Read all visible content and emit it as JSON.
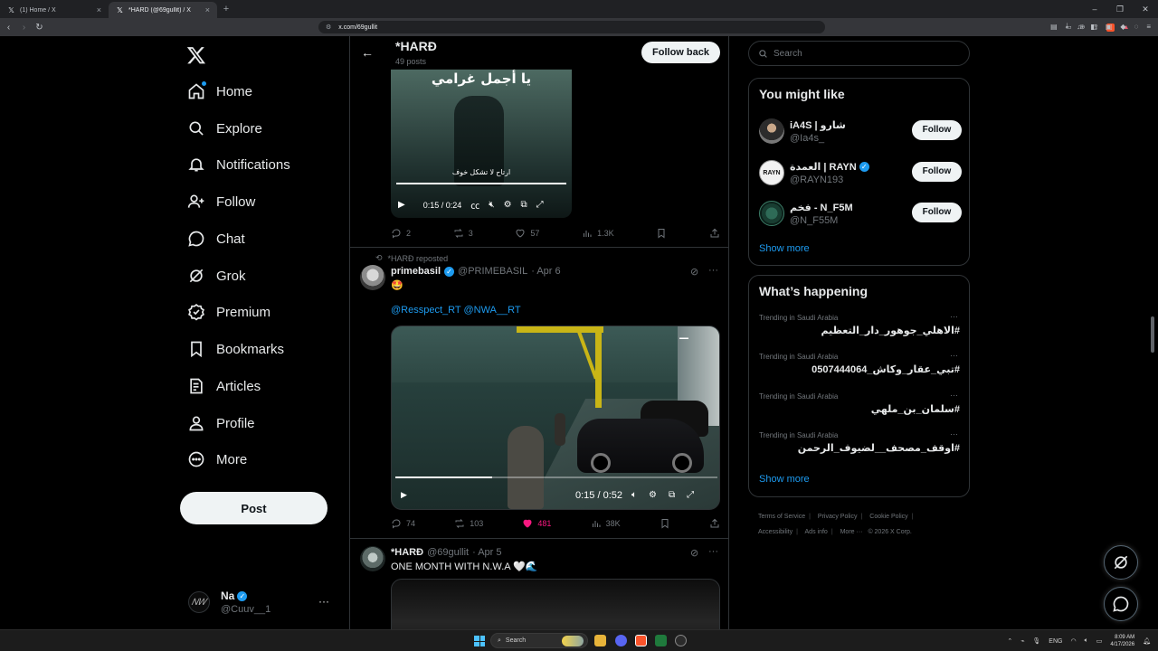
{
  "browser": {
    "tabs": [
      {
        "title": "(1) Home / X",
        "active": false
      },
      {
        "title": "*HARD (@69gullit) / X",
        "active": true
      }
    ],
    "new_tab": "+",
    "url": "x.com/69gullit",
    "window_controls": [
      "–",
      "❐",
      "✕"
    ]
  },
  "nav": {
    "items": [
      {
        "label": "Home",
        "icon": "home-icon"
      },
      {
        "label": "Explore",
        "icon": "search-icon"
      },
      {
        "label": "Notifications",
        "icon": "bell-icon"
      },
      {
        "label": "Follow",
        "icon": "person-add-icon"
      },
      {
        "label": "Chat",
        "icon": "chat-icon"
      },
      {
        "label": "Grok",
        "icon": "grok-icon"
      },
      {
        "label": "Premium",
        "icon": "premium-icon"
      },
      {
        "label": "Bookmarks",
        "icon": "bookmark-icon"
      },
      {
        "label": "Articles",
        "icon": "articles-icon"
      },
      {
        "label": "Profile",
        "icon": "profile-icon"
      },
      {
        "label": "More",
        "icon": "more-circle-icon"
      }
    ],
    "post_button": "Post",
    "account": {
      "name": "Na",
      "handle": "@Cuuv__1",
      "more": "···"
    }
  },
  "profile_header": {
    "name": "*HARĐ",
    "post_count": "49 posts",
    "follow_back": "Follow back"
  },
  "post1": {
    "video_title": "يا أجمل غرامي",
    "video_subtitle": "ارتاح لا تشكل خوف",
    "time": "0:15 / 0:24",
    "replies": "2",
    "reposts": "3",
    "likes": "57",
    "views": "1.3K"
  },
  "post2": {
    "repost_label": "*HARĐ reposted",
    "name": "primebasil",
    "handle": "@PRIMEBASIL",
    "date": "· Apr 6",
    "emoji": "🤩",
    "links": "@Resspect_RT @NWA__RT",
    "time": "0:15 / 0:52",
    "replies": "74",
    "reposts": "103",
    "likes": "481",
    "views": "38K"
  },
  "post3": {
    "name": "*HARĐ",
    "handle": "@69gullit",
    "date": "· Apr 5",
    "text": "ONE MONTH WITH N.W.A 🤍🌊"
  },
  "right": {
    "search_placeholder": "Search",
    "might_like_title": "You might like",
    "suggestions": [
      {
        "name": "iA4S | شارو",
        "handle": "@Ia4s_",
        "verified": false,
        "button": "Follow"
      },
      {
        "name": "العمدة | RAYN",
        "handle": "@RAYN193",
        "verified": true,
        "button": "Follow"
      },
      {
        "name": "فخم - N_F5M",
        "handle": "@N_F55M",
        "verified": false,
        "button": "Follow"
      }
    ],
    "show_more": "Show more",
    "happening_title": "What’s happening",
    "trends": [
      {
        "category": "Trending in Saudi Arabia",
        "text": "#الاهلي_جوهور_دار_التعظيم"
      },
      {
        "category": "Trending in Saudi Arabia",
        "text": "#تبي_عقار_وكاش_0507444064"
      },
      {
        "category": "Trending in Saudi Arabia",
        "text": "#سلمان_بن_ملهي"
      },
      {
        "category": "Trending in Saudi Arabia",
        "text": "#اوقف_مصحف__لضيوف_الرحمن"
      }
    ],
    "show_more_2": "Show more",
    "footer": [
      "Terms of Service",
      "Privacy Policy",
      "Cookie Policy",
      "Accessibility",
      "Ads info",
      "More ···",
      "© 2026 X Corp."
    ]
  },
  "taskbar": {
    "search": "Search",
    "lang": "ENG",
    "time": "8:09 AM",
    "date": "4/17/2026"
  },
  "colors": {
    "accent": "#1d9bf0",
    "like": "#f91880",
    "background": "#000000",
    "border": "#2f3336"
  }
}
